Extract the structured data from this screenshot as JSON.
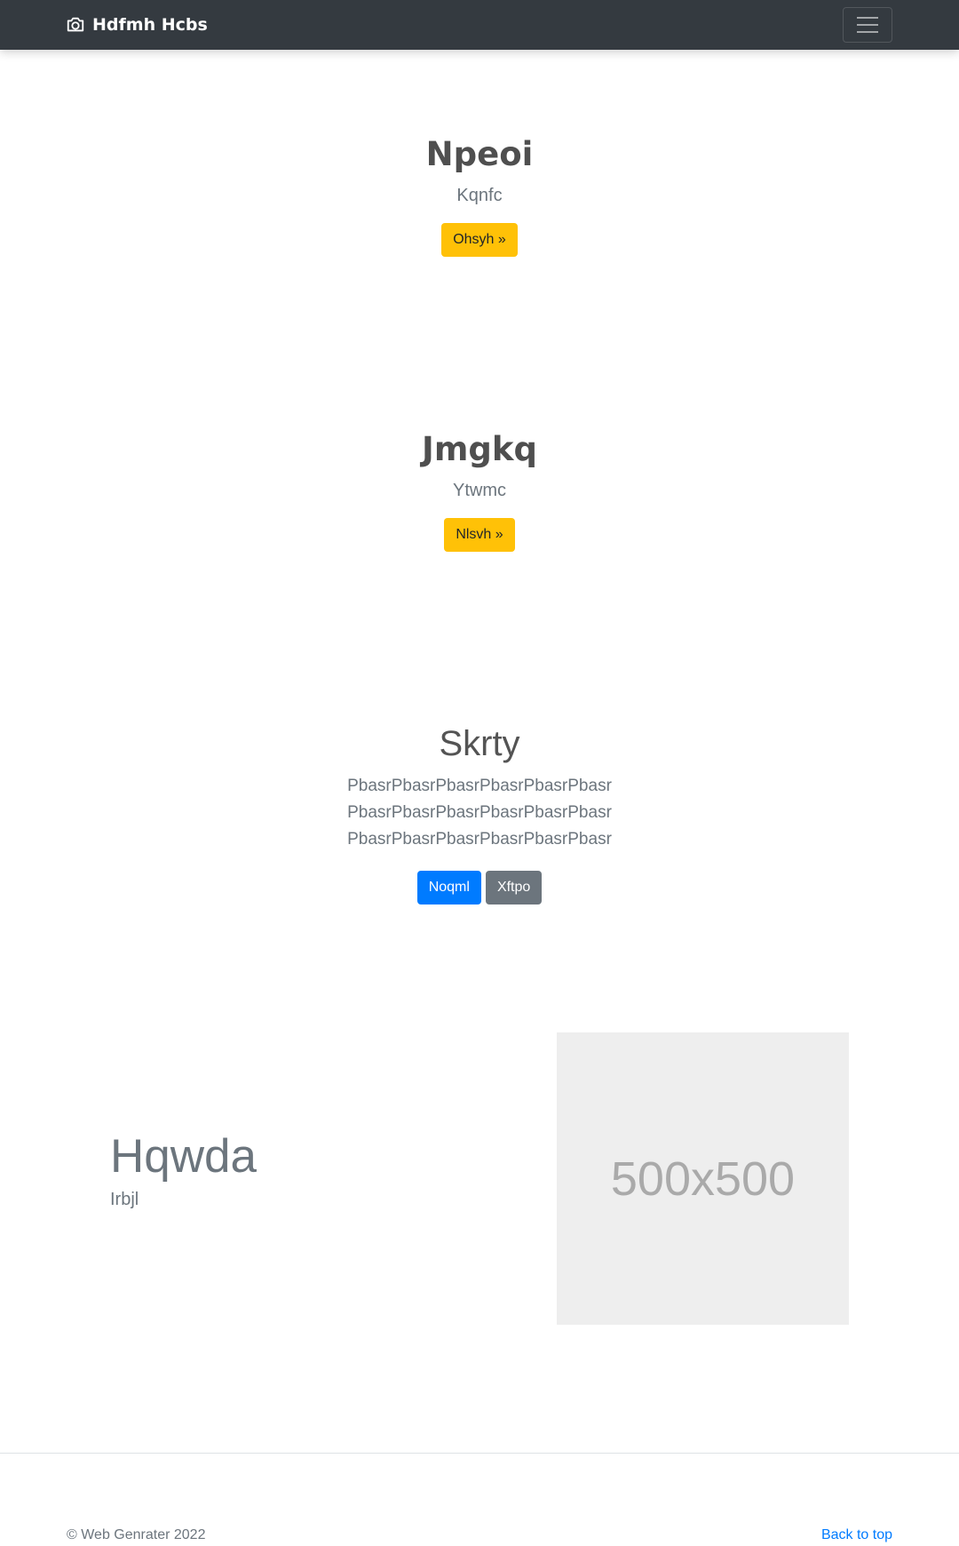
{
  "navbar": {
    "brand_icon": "camera-icon",
    "brand": "Hdfmh Hcbs",
    "toggler_icon": "hamburger-menu-icon",
    "background": "#343a40"
  },
  "hero1": {
    "title": "Npeoi",
    "lead": "Kqnfc",
    "button": "Ohsyh »",
    "button_color": "#ffc107"
  },
  "hero2": {
    "title": "Jmgkq",
    "lead": "Ytwmc",
    "button": "Nlsvh »",
    "button_color": "#ffc107"
  },
  "jumbotron": {
    "title": "Skrty",
    "description": "PbasrPbasrPbasrPbasrPbasrPbasr PbasrPbasrPbasrPbasrPbasrPbasr PbasrPbasrPbasrPbasrPbasrPbasr",
    "primary_button": "Noqml",
    "secondary_button": "Xftpo",
    "primary_color": "#007bff",
    "secondary_color": "#6c757d"
  },
  "feature": {
    "title": "Hqwda",
    "subtitle": "Irbjl",
    "image_label": "500x500"
  },
  "footer": {
    "copyright": "© Web Genrater 2022",
    "back_to_top": "Back to top"
  }
}
